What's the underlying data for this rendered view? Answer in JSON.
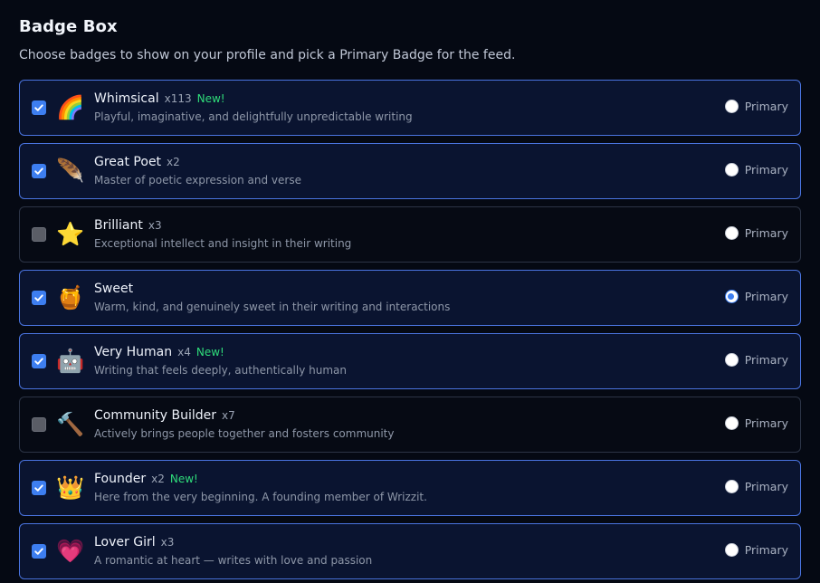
{
  "header": {
    "title": "Badge Box",
    "subtitle": "Choose badges to show on your profile and pick a Primary Badge for the feed."
  },
  "primary_label": "Primary",
  "badges": [
    {
      "emoji": "🌈",
      "icon": "rainbow-icon",
      "name": "Whimsical",
      "count": "x113",
      "new": "New!",
      "desc": "Playful, imaginative, and delightfully unpredictable writing",
      "checked": true,
      "primary": false
    },
    {
      "emoji": "🪶",
      "icon": "feather-icon",
      "name": "Great Poet",
      "count": "x2",
      "new": "",
      "desc": "Master of poetic expression and verse",
      "checked": true,
      "primary": false
    },
    {
      "emoji": "⭐",
      "icon": "star-icon",
      "name": "Brilliant",
      "count": "x3",
      "new": "",
      "desc": "Exceptional intellect and insight in their writing",
      "checked": false,
      "primary": false
    },
    {
      "emoji": "🍯",
      "icon": "honey-pot-icon",
      "name": "Sweet",
      "count": "",
      "new": "",
      "desc": "Warm, kind, and genuinely sweet in their writing and interactions",
      "checked": true,
      "primary": true
    },
    {
      "emoji": "🤖",
      "icon": "robot-icon",
      "name": "Very Human",
      "count": "x4",
      "new": "New!",
      "desc": "Writing that feels deeply, authentically human",
      "checked": true,
      "primary": false
    },
    {
      "emoji": "🔨",
      "icon": "hammer-icon",
      "name": "Community Builder",
      "count": "x7",
      "new": "",
      "desc": "Actively brings people together and fosters community",
      "checked": false,
      "primary": false
    },
    {
      "emoji": "👑",
      "icon": "crown-icon",
      "name": "Founder",
      "count": "x2",
      "new": "New!",
      "desc": "Here from the very beginning. A founding member of Wrizzit.",
      "checked": true,
      "primary": false
    },
    {
      "emoji": "💗",
      "icon": "heart-icon",
      "name": "Lover Girl",
      "count": "x3",
      "new": "",
      "desc": "A romantic at heart — writes with love and passion",
      "checked": true,
      "primary": false
    }
  ],
  "colors": {
    "accent": "#3d7ef0",
    "new_badge": "#2fdc7a",
    "selected_border": "#4a74e0",
    "background": "#050913"
  }
}
